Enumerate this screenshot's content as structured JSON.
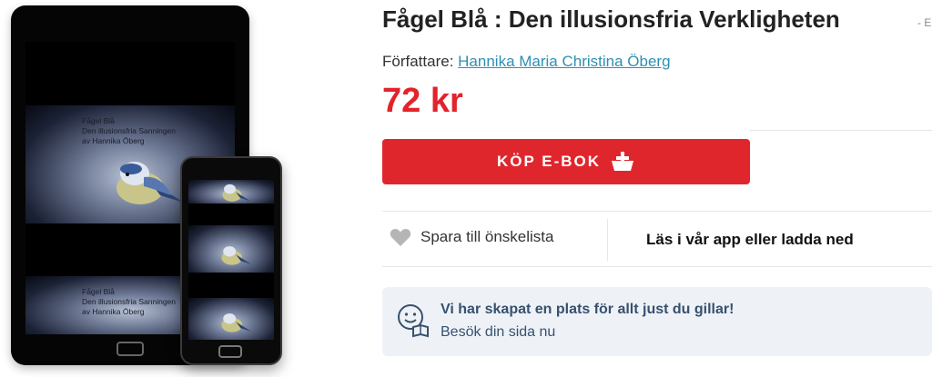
{
  "product": {
    "title": "Fågel Blå : Den illusionsfria Verkligheten",
    "title_suffix": "- E",
    "author_label": "Författare:",
    "author_name": "Hannika Maria Christina Öberg",
    "price": "72 kr"
  },
  "cover": {
    "line1": "Fågel Blå",
    "line2": "Den illusionsfria Sanningen",
    "line3": "av Hannika Öberg"
  },
  "actions": {
    "buy_label": "KÖP E-BOK",
    "wishlist_label": "Spara till önskelista",
    "app_label": "Läs i vår app eller ladda ned"
  },
  "promo": {
    "title": "Vi har skapat en plats för allt just du gillar!",
    "link": "Besök din sida nu"
  },
  "colors": {
    "accent": "#e0262d",
    "price": "#e3232b",
    "author_link": "#2f8fb3",
    "promo_bg": "#eef2f7",
    "promo_text": "#37506e"
  },
  "icons": {
    "buy": "basket-icon",
    "wishlist": "heart-icon",
    "promo": "smiley-book-icon"
  }
}
